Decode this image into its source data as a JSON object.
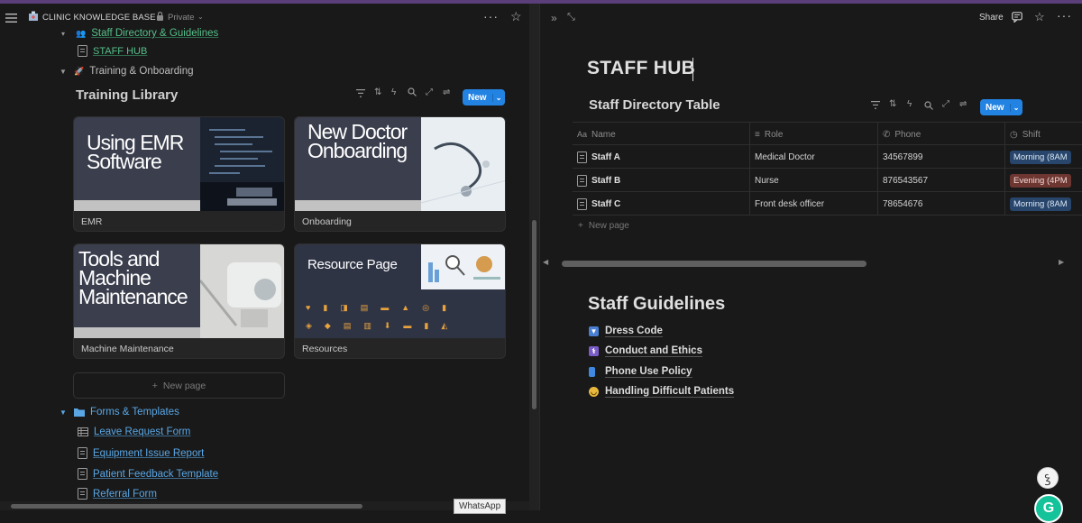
{
  "left": {
    "workspace_name": "CLINIC KNOWLEDGE BASE",
    "privacy": "Private",
    "tree": [
      {
        "label": "Staff Directory & Guidelines",
        "type": "partial"
      },
      {
        "label": "STAFF HUB",
        "type": "page"
      },
      {
        "label": "Training & Onboarding",
        "type": "section"
      }
    ],
    "library": {
      "title": "Training Library",
      "new_label": "New",
      "cards": [
        {
          "cover_text": "Using EMR Software",
          "name": "EMR"
        },
        {
          "cover_text": "New Doctor Onboarding",
          "name": "Onboarding"
        },
        {
          "cover_text": "Tools and Machine Maintenance",
          "name": "Machine Maintenance"
        },
        {
          "cover_text": "Resource Page",
          "name": "Resources"
        }
      ],
      "new_page": "New page"
    },
    "forms": {
      "label": "Forms & Templates",
      "items": [
        "Leave Request Form",
        "Equipment Issue Report",
        "Patient Feedback Template",
        "Referral Form"
      ]
    },
    "tooltip": "WhatsApp"
  },
  "right": {
    "share": "Share",
    "page_title": "STAFF HUB",
    "database": {
      "title": "Staff Directory Table",
      "new_label": "New",
      "columns": [
        {
          "label": "Name",
          "icon": "Aa"
        },
        {
          "label": "Role",
          "icon": "list-icon"
        },
        {
          "label": "Phone",
          "icon": "phone-icon"
        },
        {
          "label": "Shift",
          "icon": "clock-icon"
        }
      ],
      "rows": [
        {
          "name": "Staff A",
          "role": "Medical Doctor",
          "phone": "34567899",
          "shift": "Morning (8AM",
          "shift_color": "#28456c"
        },
        {
          "name": "Staff B",
          "role": "Nurse",
          "phone": "876543567",
          "shift": "Evening (4PM",
          "shift_color": "#6e3630"
        },
        {
          "name": "Staff C",
          "role": "Front desk officer",
          "phone": "78654676",
          "shift": "Morning (8AM",
          "shift_color": "#28456c"
        }
      ],
      "new_page": "New page"
    },
    "guidelines": {
      "heading": "Staff Guidelines",
      "items": [
        {
          "label": "Dress Code",
          "icon": "dress-icon"
        },
        {
          "label": "Conduct and Ethics",
          "icon": "medical-symbol-icon"
        },
        {
          "label": "Phone Use Policy",
          "icon": "phone-icon"
        },
        {
          "label": "Handling Difficult Patients",
          "icon": "face-icon"
        }
      ]
    }
  }
}
